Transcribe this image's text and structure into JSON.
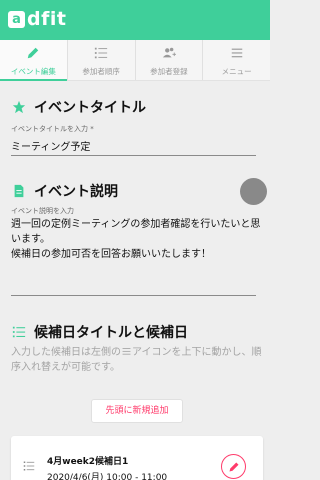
{
  "app": {
    "logo_letter": "a",
    "name": "dfit"
  },
  "tabs": [
    {
      "label": "イベント編集",
      "icon": "pencil-icon",
      "active": true
    },
    {
      "label": "参加者順序",
      "icon": "ordered-list-icon",
      "active": false
    },
    {
      "label": "参加者登録",
      "icon": "add-users-icon",
      "active": false
    },
    {
      "label": "メニュー",
      "icon": "menu-icon",
      "active": false
    }
  ],
  "event_title": {
    "heading": "イベントタイトル",
    "label": "イベントタイトルを入力 *",
    "value": "ミーティング予定"
  },
  "event_description": {
    "heading": "イベント説明",
    "label": "イベント説明を入力",
    "value": "週一回の定例ミーティングの参加者確認を行いたいと思います。\n候補日の参加可否を回答お願いいたします！"
  },
  "candidates": {
    "heading": "候補日タイトルと候補日",
    "hint_before": "入力した候補日は左側の",
    "hint_icon_label": "アイコンを上下に動かし、順序入れ替えが可能です。",
    "add_button": "先頭に新規追加",
    "items": [
      {
        "title": "4月week2候補日1",
        "date": "2020/4/6(月) 10:00 - 11:00"
      }
    ]
  },
  "colors": {
    "accent": "#3fcf9a",
    "pink": "#ff3b6b"
  }
}
